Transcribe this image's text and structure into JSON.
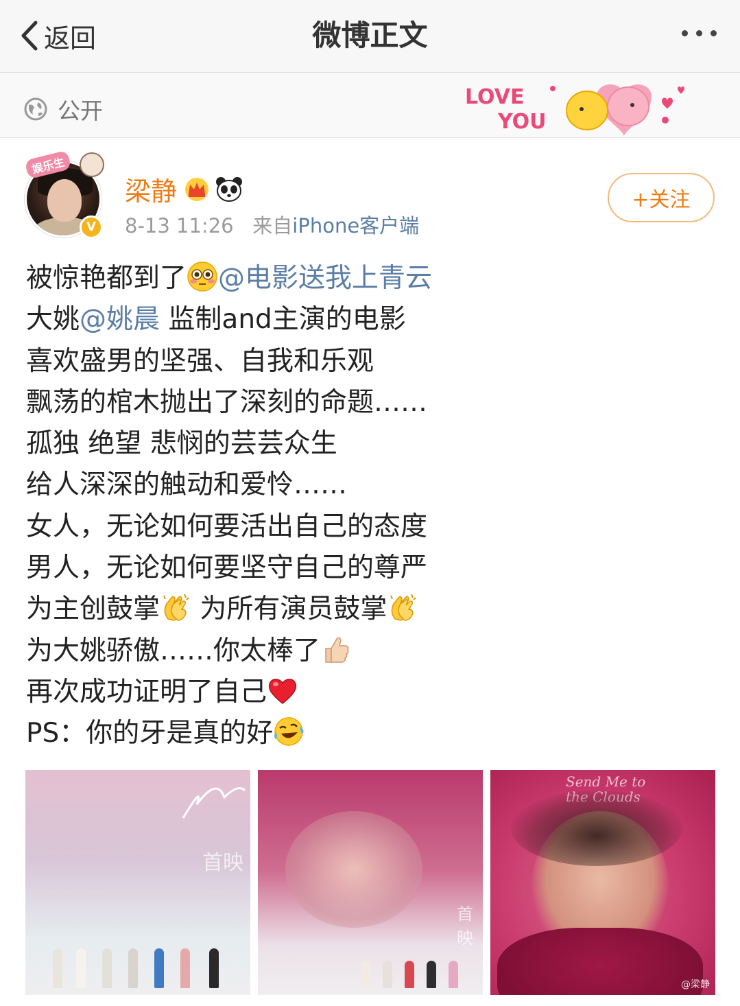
{
  "nav": {
    "back_label": "返回",
    "title": "微博正文"
  },
  "visibility": {
    "label": "公开",
    "decor_text_1": "LOVE",
    "decor_text_2": "YOU"
  },
  "post": {
    "avatar_tag": "娱乐生",
    "username": "梁静",
    "time": "8-13 11:26",
    "source_prefix": "来自",
    "source": "iPhone客户端",
    "follow_label": "+关注",
    "lines": {
      "l1a": "被惊艳都到了",
      "l1b": "@电影送我上青云",
      "l2a": "大姚",
      "l2b": "@姚晨",
      "l2c": " 监制and主演的电影",
      "l3": "喜欢盛男的坚强、自我和乐观",
      "l4": "飘荡的棺木抛出了深刻的命题……",
      "l5": "孤独 绝望 悲悯的芸芸众生",
      "l6": "给人深深的触动和爱怜……",
      "l7": "女人，无论如何要活出自己的态度",
      "l8": "男人，无论如何要坚守自己的尊严",
      "l9a": "为主创鼓掌",
      "l9b": " 为所有演员鼓掌",
      "l10": "为大姚骄傲……你太棒了",
      "l11": "再次成功证明了自己",
      "l12": "PS：你的牙是真的好"
    },
    "photos": {
      "screen_text": "首映",
      "poster_title": "Send Me to the Clouds",
      "watermark": "@梁静"
    }
  },
  "colors": {
    "username": "#f07b13",
    "link": "#5b7ea6",
    "meta": "#9b9b9b"
  },
  "icons": [
    "chevron-left-icon",
    "more-icon",
    "globe-icon",
    "crown-icon",
    "panda-icon",
    "flushed-face-emoji",
    "clapping-hands-emoji",
    "thumbs-up-emoji",
    "red-heart-emoji",
    "laughing-tears-emoji",
    "verified-badge-icon"
  ]
}
